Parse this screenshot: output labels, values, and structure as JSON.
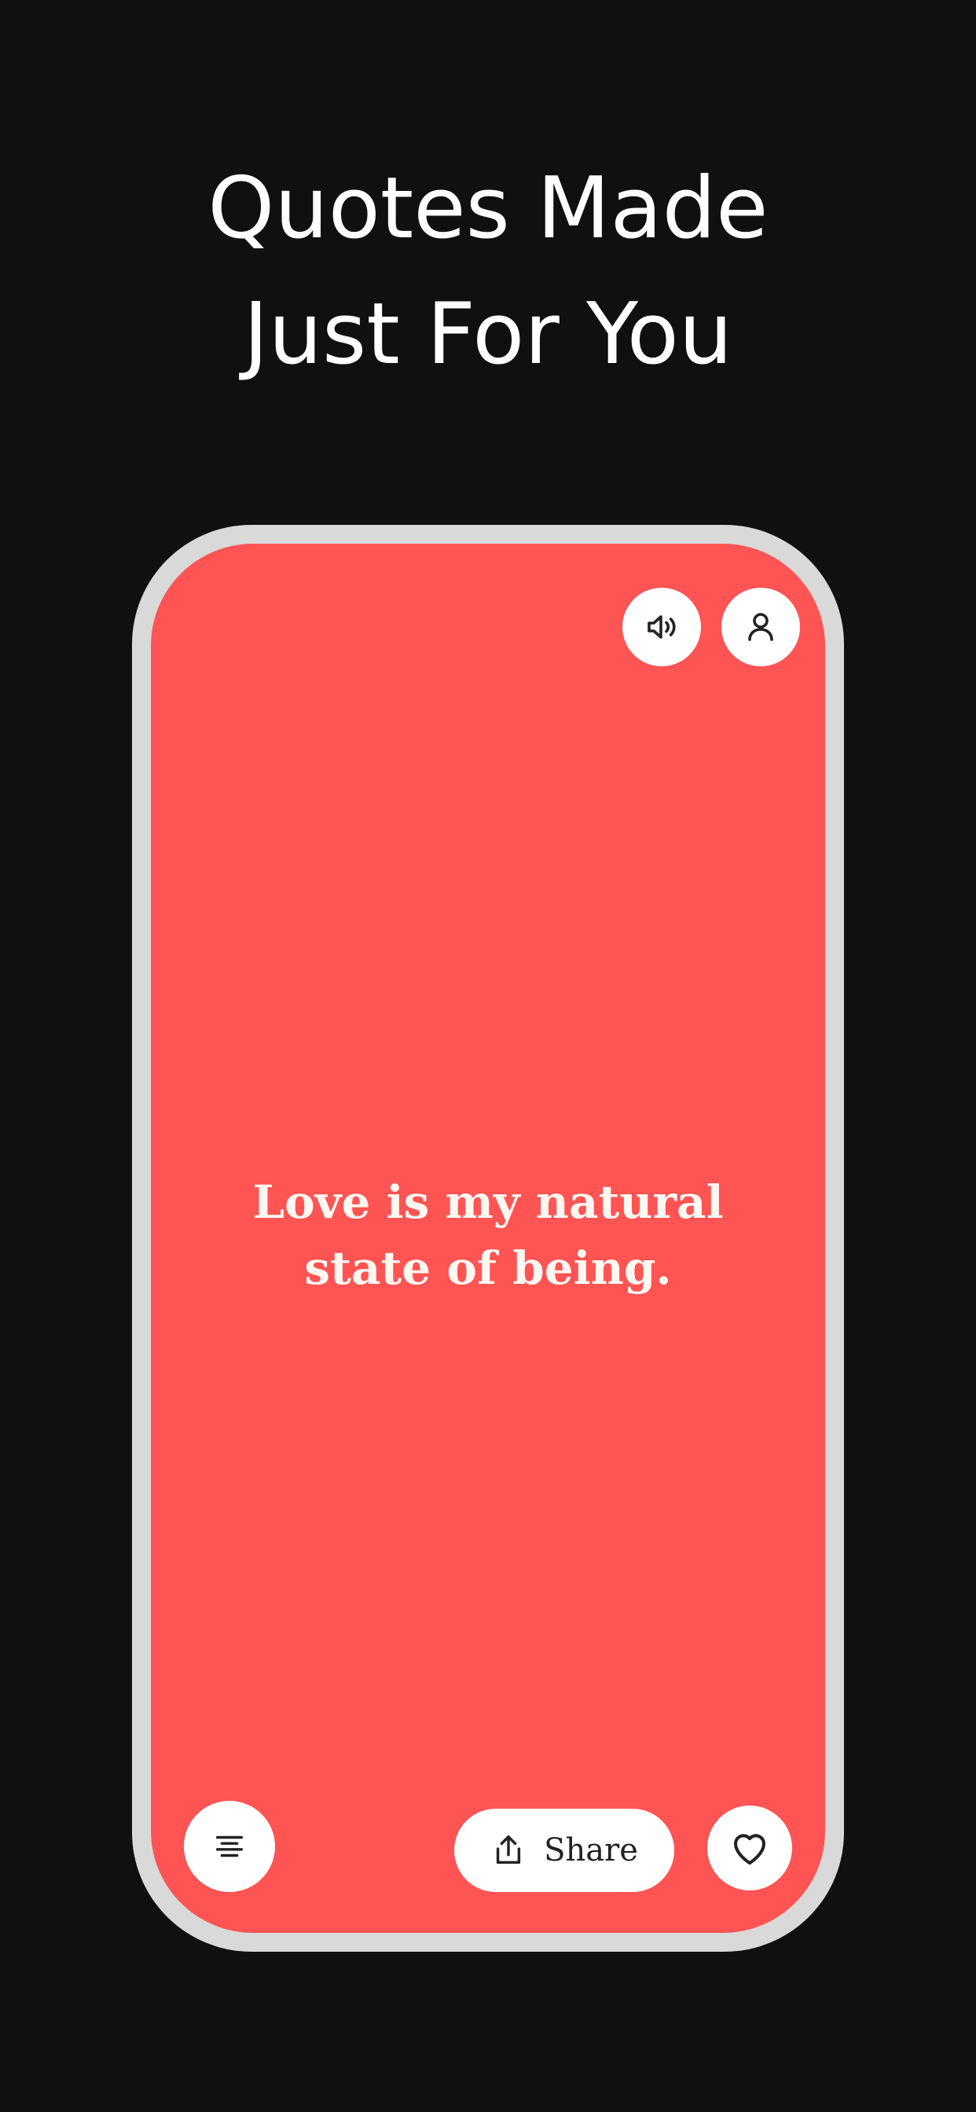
{
  "headline": {
    "line1": "Quotes Made",
    "line2": "Just For You"
  },
  "quote": {
    "text": "Love is my natural state of being."
  },
  "toolbar": {
    "share_label": "Share"
  },
  "icons": {
    "sound": "speaker-icon",
    "profile": "user-icon",
    "menu": "text-align-center-icon",
    "share": "share-icon",
    "like": "heart-icon"
  },
  "colors": {
    "background": "#101010",
    "phone_frame": "#d9d9d9",
    "screen": "#fe5454",
    "button": "#ffffff",
    "icon": "#222222",
    "quote_text": "#fff7f0"
  }
}
